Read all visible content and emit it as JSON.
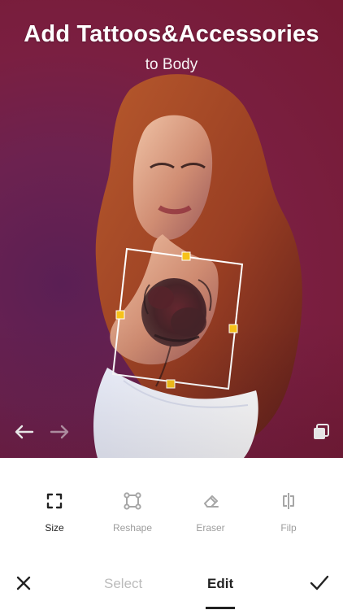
{
  "header": {
    "title": "Add Tattoos&Accessories",
    "subtitle": "to Body"
  },
  "tools": [
    {
      "label": "Size",
      "icon": "size-icon",
      "active": true
    },
    {
      "label": "Reshape",
      "icon": "reshape-icon",
      "active": false
    },
    {
      "label": "Eraser",
      "icon": "eraser-icon",
      "active": false
    },
    {
      "label": "Filp",
      "icon": "flip-icon",
      "active": false
    }
  ],
  "bottom_tabs": {
    "select": "Select",
    "edit": "Edit"
  },
  "colors": {
    "background_photo": "#7a1f41",
    "handle": "#f7c21a",
    "text_inactive": "#9c9c9c",
    "text_active": "#222222"
  }
}
